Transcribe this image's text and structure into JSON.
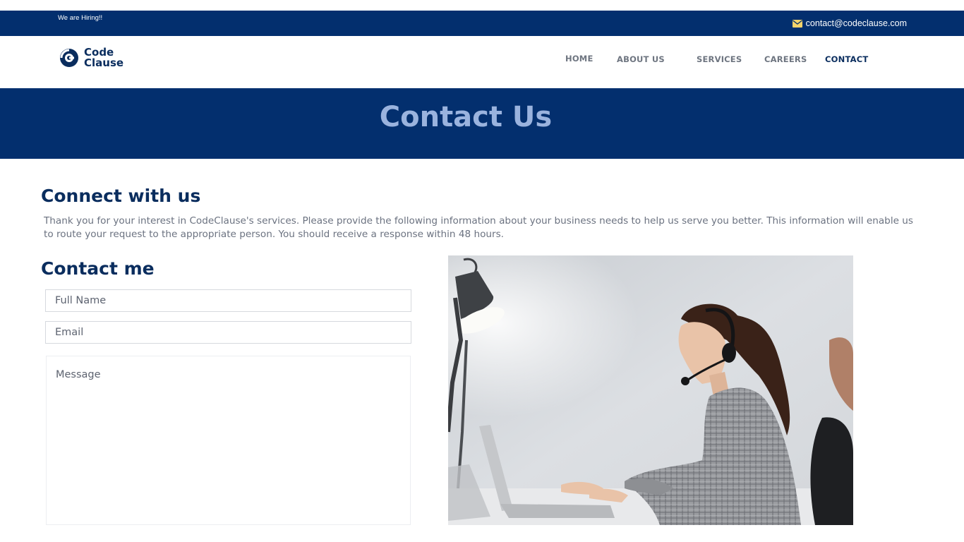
{
  "topbar": {
    "hiring_text": "We are Hiring!!",
    "email": "contact@codeclause.com",
    "mail_icon": "envelope-icon",
    "bg_color": "#032f6e",
    "icon_color": "#f5d36a"
  },
  "brand": {
    "line1": "Code",
    "line2": "Clause",
    "logo_icon": "codeclause-logo-icon"
  },
  "nav": {
    "items": [
      {
        "label": "HOME"
      },
      {
        "label": "ABOUT US"
      },
      {
        "label": "SERVICES"
      },
      {
        "label": "CAREERS"
      },
      {
        "label": "CONTACT",
        "active": true
      }
    ]
  },
  "hero": {
    "title": "Contact Us",
    "bg_color": "#032f6e",
    "title_color": "#9ab3de"
  },
  "connect": {
    "heading": "Connect with us",
    "text": "Thank you for your interest in CodeClause's services. Please provide the following information about your business needs to help us serve you better. This information will enable us to route your request to the appropriate person. You should receive a response within 48 hours."
  },
  "form": {
    "heading": "Contact me",
    "name_placeholder": "Full Name",
    "email_placeholder": "Email",
    "message_placeholder": "Message"
  }
}
